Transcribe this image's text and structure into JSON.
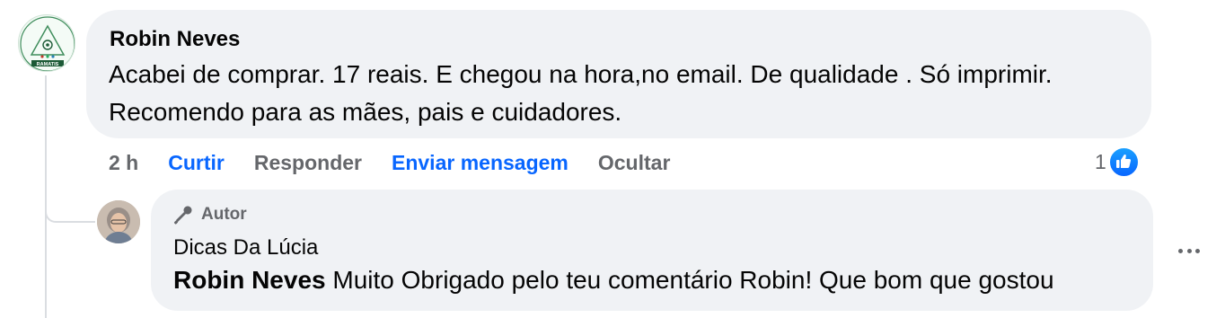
{
  "comment": {
    "author": "Robin Neves",
    "avatar_text": "RAMATIS",
    "text": "Acabei de comprar. 17 reais. E chegou na hora,no email. De qualidade . Só imprimir. Recomendo para as mães, pais e cuidadores.",
    "time": "2 h",
    "actions": {
      "like": "Curtir",
      "reply": "Responder",
      "message": "Enviar mensagem",
      "hide": "Ocultar"
    },
    "reaction_count": "1",
    "reaction_icon": "thumbs-up-icon"
  },
  "reply": {
    "badge": "Autor",
    "badge_icon": "microphone-icon",
    "author": "Dicas Da Lúcia",
    "mention": "Robin Neves",
    "text": " Muito Obrigado pelo teu comentário Robin! Que bom que gostou"
  },
  "colors": {
    "bubble": "#f0f2f5",
    "accent": "#0866ff",
    "muted": "#65676b"
  }
}
